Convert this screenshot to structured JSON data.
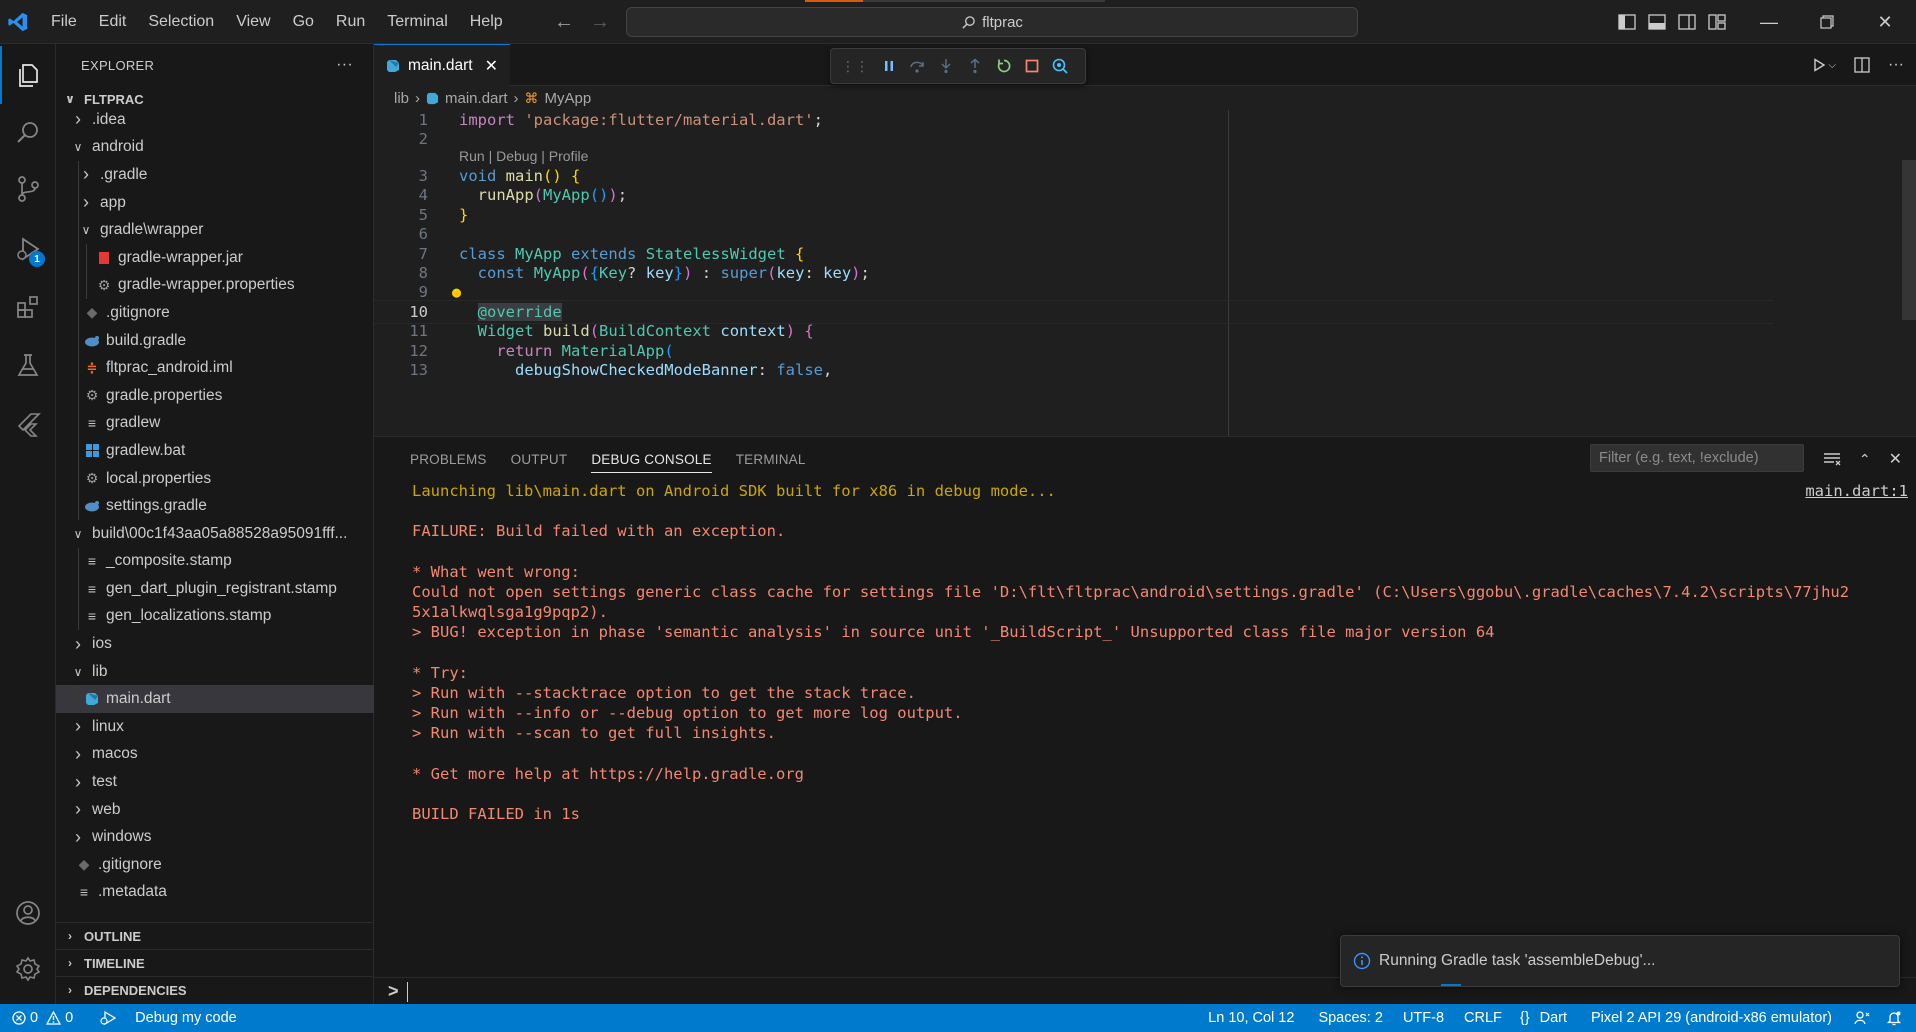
{
  "titlebar": {
    "menu": [
      "File",
      "Edit",
      "Selection",
      "View",
      "Go",
      "Run",
      "Terminal",
      "Help"
    ],
    "search_text": "fltprac"
  },
  "sidebar": {
    "header": "EXPLORER",
    "more": "···",
    "folder": "FLTPRAC",
    "items": [
      {
        "label": ".idea",
        "depth": 0,
        "type": "folder",
        "expanded": false
      },
      {
        "label": "android",
        "depth": 0,
        "type": "folder",
        "expanded": true
      },
      {
        "label": ".gradle",
        "depth": 1,
        "type": "folder",
        "expanded": false
      },
      {
        "label": "app",
        "depth": 1,
        "type": "folder",
        "expanded": false
      },
      {
        "label": "gradle\\wrapper",
        "depth": 1,
        "type": "folder",
        "expanded": true
      },
      {
        "label": "gradle-wrapper.jar",
        "depth": 2,
        "type": "jar"
      },
      {
        "label": "gradle-wrapper.properties",
        "depth": 2,
        "type": "gear"
      },
      {
        "label": ".gitignore",
        "depth": 1,
        "type": "git"
      },
      {
        "label": "build.gradle",
        "depth": 1,
        "type": "gradle"
      },
      {
        "label": "fltprac_android.iml",
        "depth": 1,
        "type": "rss"
      },
      {
        "label": "gradle.properties",
        "depth": 1,
        "type": "gear"
      },
      {
        "label": "gradlew",
        "depth": 1,
        "type": "lines"
      },
      {
        "label": "gradlew.bat",
        "depth": 1,
        "type": "windows"
      },
      {
        "label": "local.properties",
        "depth": 1,
        "type": "gear"
      },
      {
        "label": "settings.gradle",
        "depth": 1,
        "type": "gradle"
      },
      {
        "label": "build\\00c1f43aa05a88528a95091fff...",
        "depth": 0,
        "type": "folder",
        "expanded": true
      },
      {
        "label": "_composite.stamp",
        "depth": 1,
        "type": "lines"
      },
      {
        "label": "gen_dart_plugin_registrant.stamp",
        "depth": 1,
        "type": "lines"
      },
      {
        "label": "gen_localizations.stamp",
        "depth": 1,
        "type": "lines"
      },
      {
        "label": "ios",
        "depth": 0,
        "type": "folder",
        "expanded": false
      },
      {
        "label": "lib",
        "depth": 0,
        "type": "folder",
        "expanded": true
      },
      {
        "label": "main.dart",
        "depth": 1,
        "type": "dart",
        "selected": true
      },
      {
        "label": "linux",
        "depth": 0,
        "type": "folder",
        "expanded": false
      },
      {
        "label": "macos",
        "depth": 0,
        "type": "folder",
        "expanded": false
      },
      {
        "label": "test",
        "depth": 0,
        "type": "folder",
        "expanded": false
      },
      {
        "label": "web",
        "depth": 0,
        "type": "folder",
        "expanded": false
      },
      {
        "label": "windows",
        "depth": 0,
        "type": "folder",
        "expanded": false
      },
      {
        "label": ".gitignore",
        "depth": 0,
        "type": "git"
      },
      {
        "label": ".metadata",
        "depth": 0,
        "type": "lines"
      }
    ],
    "sections": [
      "OUTLINE",
      "TIMELINE",
      "DEPENDENCIES"
    ]
  },
  "activity_badge": "1",
  "editor": {
    "tab_label": "main.dart",
    "breadcrumb": [
      "lib",
      "main.dart",
      "MyApp"
    ],
    "codelens": "Run | Debug | Profile"
  },
  "panel": {
    "tabs": [
      "PROBLEMS",
      "OUTPUT",
      "DEBUG CONSOLE",
      "TERMINAL"
    ],
    "active_tab": "DEBUG CONSOLE",
    "filter_placeholder": "Filter (e.g. text, !exclude)",
    "source_link": "main.dart:1",
    "console": [
      {
        "text": "Launching lib\\main.dart on Android SDK built for x86 in debug mode...",
        "color": "yellow"
      },
      {
        "text": "",
        "color": "red"
      },
      {
        "text": "FAILURE: Build failed with an exception.",
        "color": "red"
      },
      {
        "text": "",
        "color": "red"
      },
      {
        "text": "* What went wrong:",
        "color": "red"
      },
      {
        "text": "Could not open settings generic class cache for settings file 'D:\\flt\\fltprac\\android\\settings.gradle' (C:\\Users\\ggobu\\.gradle\\caches\\7.4.2\\scripts\\77jhu2",
        "color": "red"
      },
      {
        "text": "5x1alkwqlsga1g9pqp2).",
        "color": "red"
      },
      {
        "text": "> BUG! exception in phase 'semantic analysis' in source unit '_BuildScript_' Unsupported class file major version 64",
        "color": "red"
      },
      {
        "text": "",
        "color": "red"
      },
      {
        "text": "* Try:",
        "color": "red"
      },
      {
        "text": "> Run with --stacktrace option to get the stack trace.",
        "color": "red"
      },
      {
        "text": "> Run with --info or --debug option to get more log output.",
        "color": "red"
      },
      {
        "text": "> Run with --scan to get full insights.",
        "color": "red"
      },
      {
        "text": "",
        "color": "red"
      },
      {
        "text": "* Get more help at https://help.gradle.org",
        "color": "red"
      },
      {
        "text": "",
        "color": "red"
      },
      {
        "text": "BUILD FAILED in 1s",
        "color": "red"
      }
    ],
    "prompt": ">"
  },
  "notification": {
    "text": "Running Gradle task 'assembleDebug'..."
  },
  "statusbar": {
    "errors": "0",
    "warnings": "0",
    "debug_label": "Debug my code",
    "position": "Ln 10, Col 12",
    "spaces": "Spaces: 2",
    "encoding": "UTF-8",
    "eol": "CRLF",
    "language": "Dart",
    "device": "Pixel 2 API 29 (android-x86 emulator)"
  },
  "colors": {
    "accent": "#007acc",
    "console_yellow": "#cca700",
    "console_red": "#f48771"
  }
}
